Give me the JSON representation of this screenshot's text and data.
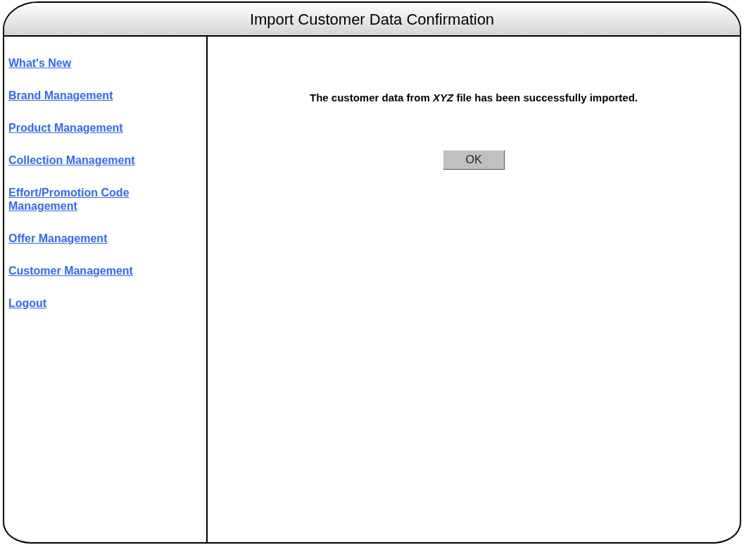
{
  "window": {
    "title": "Import Customer Data Confirmation"
  },
  "sidebar": {
    "items": [
      {
        "label": "What's New"
      },
      {
        "label": "Brand Management"
      },
      {
        "label": "Product Management"
      },
      {
        "label": "Collection Management"
      },
      {
        "label": "Effort/Promotion Code Management"
      },
      {
        "label": "Offer Management"
      },
      {
        "label": "Customer Management"
      },
      {
        "label": "Logout"
      }
    ]
  },
  "message": "The customer data from *XYZ* file has been successfully imported.",
  "buttons": [
    "OK"
  ]
}
